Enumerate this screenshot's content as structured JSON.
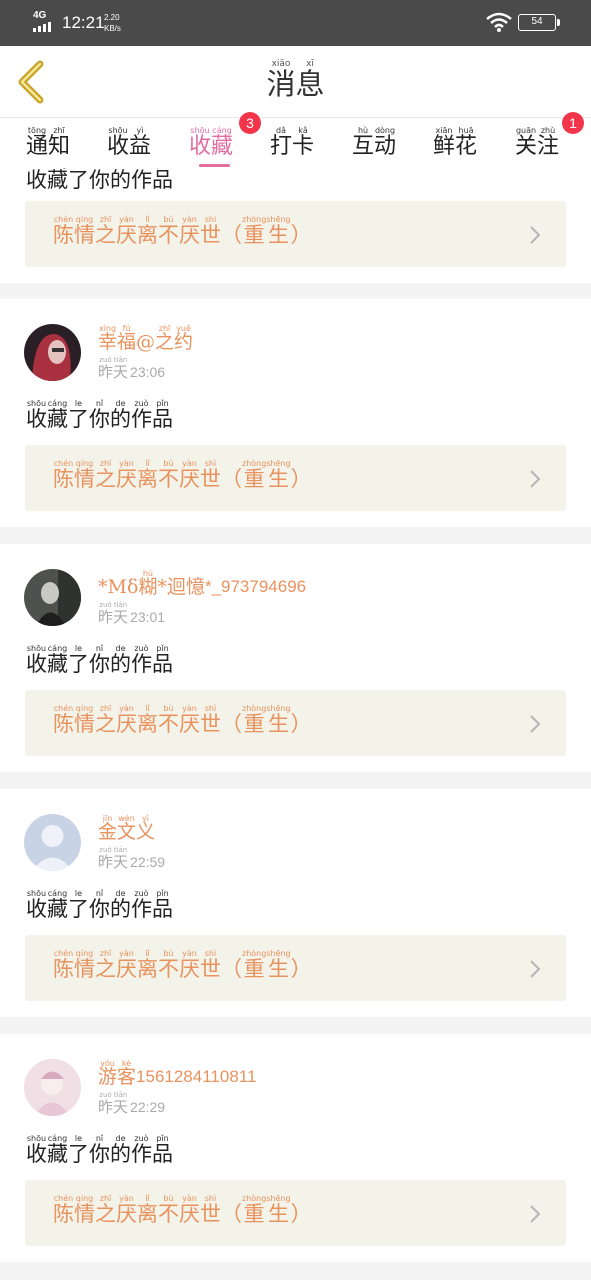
{
  "status_bar": {
    "network": "4G",
    "time": "12:21",
    "speed_value": "2.20",
    "speed_unit": "KB/s",
    "battery": "54"
  },
  "header": {
    "title": [
      [
        "xiāo",
        "消"
      ],
      [
        "xī",
        "息"
      ]
    ]
  },
  "tabs": [
    {
      "label": [
        [
          "tōng",
          "通"
        ],
        [
          "zhī",
          "知"
        ]
      ]
    },
    {
      "label": [
        [
          "shōu",
          "收"
        ],
        [
          "yì",
          "益"
        ]
      ]
    },
    {
      "label": [
        [
          "shōu",
          "收"
        ],
        [
          "cáng",
          "藏"
        ]
      ],
      "active": true,
      "badge": "3"
    },
    {
      "label": [
        [
          "dǎ",
          "打"
        ],
        [
          "kǎ",
          "卡"
        ]
      ]
    },
    {
      "label": [
        [
          "hù",
          "互"
        ],
        [
          "dòng",
          "动"
        ]
      ]
    },
    {
      "label": [
        [
          "xiān",
          "鲜"
        ],
        [
          "huā",
          "花"
        ]
      ]
    },
    {
      "label": [
        [
          "guān",
          "关"
        ],
        [
          "zhù",
          "注"
        ]
      ],
      "badge": "1"
    }
  ],
  "work_title": [
    [
      "chén",
      "陈"
    ],
    [
      "qíng",
      "情"
    ],
    [
      "zhī",
      "之"
    ],
    [
      "yàn",
      "厌"
    ],
    [
      "lǐ",
      "离"
    ],
    [
      "bù",
      "不"
    ],
    [
      "yàn",
      "厌"
    ],
    [
      "shì",
      "世"
    ],
    [
      "",
      "（"
    ],
    [
      "zhòng",
      "重"
    ],
    [
      "shēng",
      "生"
    ],
    [
      "",
      "）"
    ]
  ],
  "action_text": [
    [
      "shōu",
      "收"
    ],
    [
      "cáng",
      "藏"
    ],
    [
      "le",
      "了"
    ],
    [
      "nǐ",
      "你"
    ],
    [
      "de",
      "的"
    ],
    [
      "zuò",
      "作"
    ],
    [
      "pǐn",
      "品"
    ]
  ],
  "time_prefix": [
    [
      "zuó",
      "昨"
    ],
    [
      "tiān",
      "天"
    ]
  ],
  "notifications": [
    {
      "user": [
        [
          "xìng",
          "幸"
        ],
        [
          "fú",
          "福"
        ],
        [
          "",
          "@"
        ],
        [
          "zhī",
          "之"
        ],
        [
          "yuē",
          "约"
        ]
      ],
      "user_plain": "",
      "time": "23:06",
      "avatar": "red-hair-girl"
    },
    {
      "user": [
        [
          "",
          "*Mδ"
        ],
        [
          "hú",
          "糊"
        ],
        [
          "",
          "*"
        ],
        [
          "",
          "迴"
        ],
        [
          "",
          "憶"
        ]
      ],
      "user_plain": "*_973794696",
      "time": "23:01",
      "avatar": "dark-photo"
    },
    {
      "user": [
        [
          "jīn",
          "金"
        ],
        [
          "wén",
          "文"
        ],
        [
          "yì",
          "义"
        ]
      ],
      "user_plain": "",
      "time": "22:59",
      "avatar": "default-person"
    },
    {
      "user": [
        [
          "yóu",
          "游"
        ],
        [
          "kè",
          "客"
        ]
      ],
      "user_plain": "1561284110811",
      "time": "22:29",
      "avatar": "pink-girl"
    }
  ],
  "colors": {
    "accent": "#e26d9f",
    "orange_text": "#e8925e",
    "badge": "#f2354b",
    "card_bg": "#f3f3ea",
    "back_arrow": "#c8a42a"
  }
}
